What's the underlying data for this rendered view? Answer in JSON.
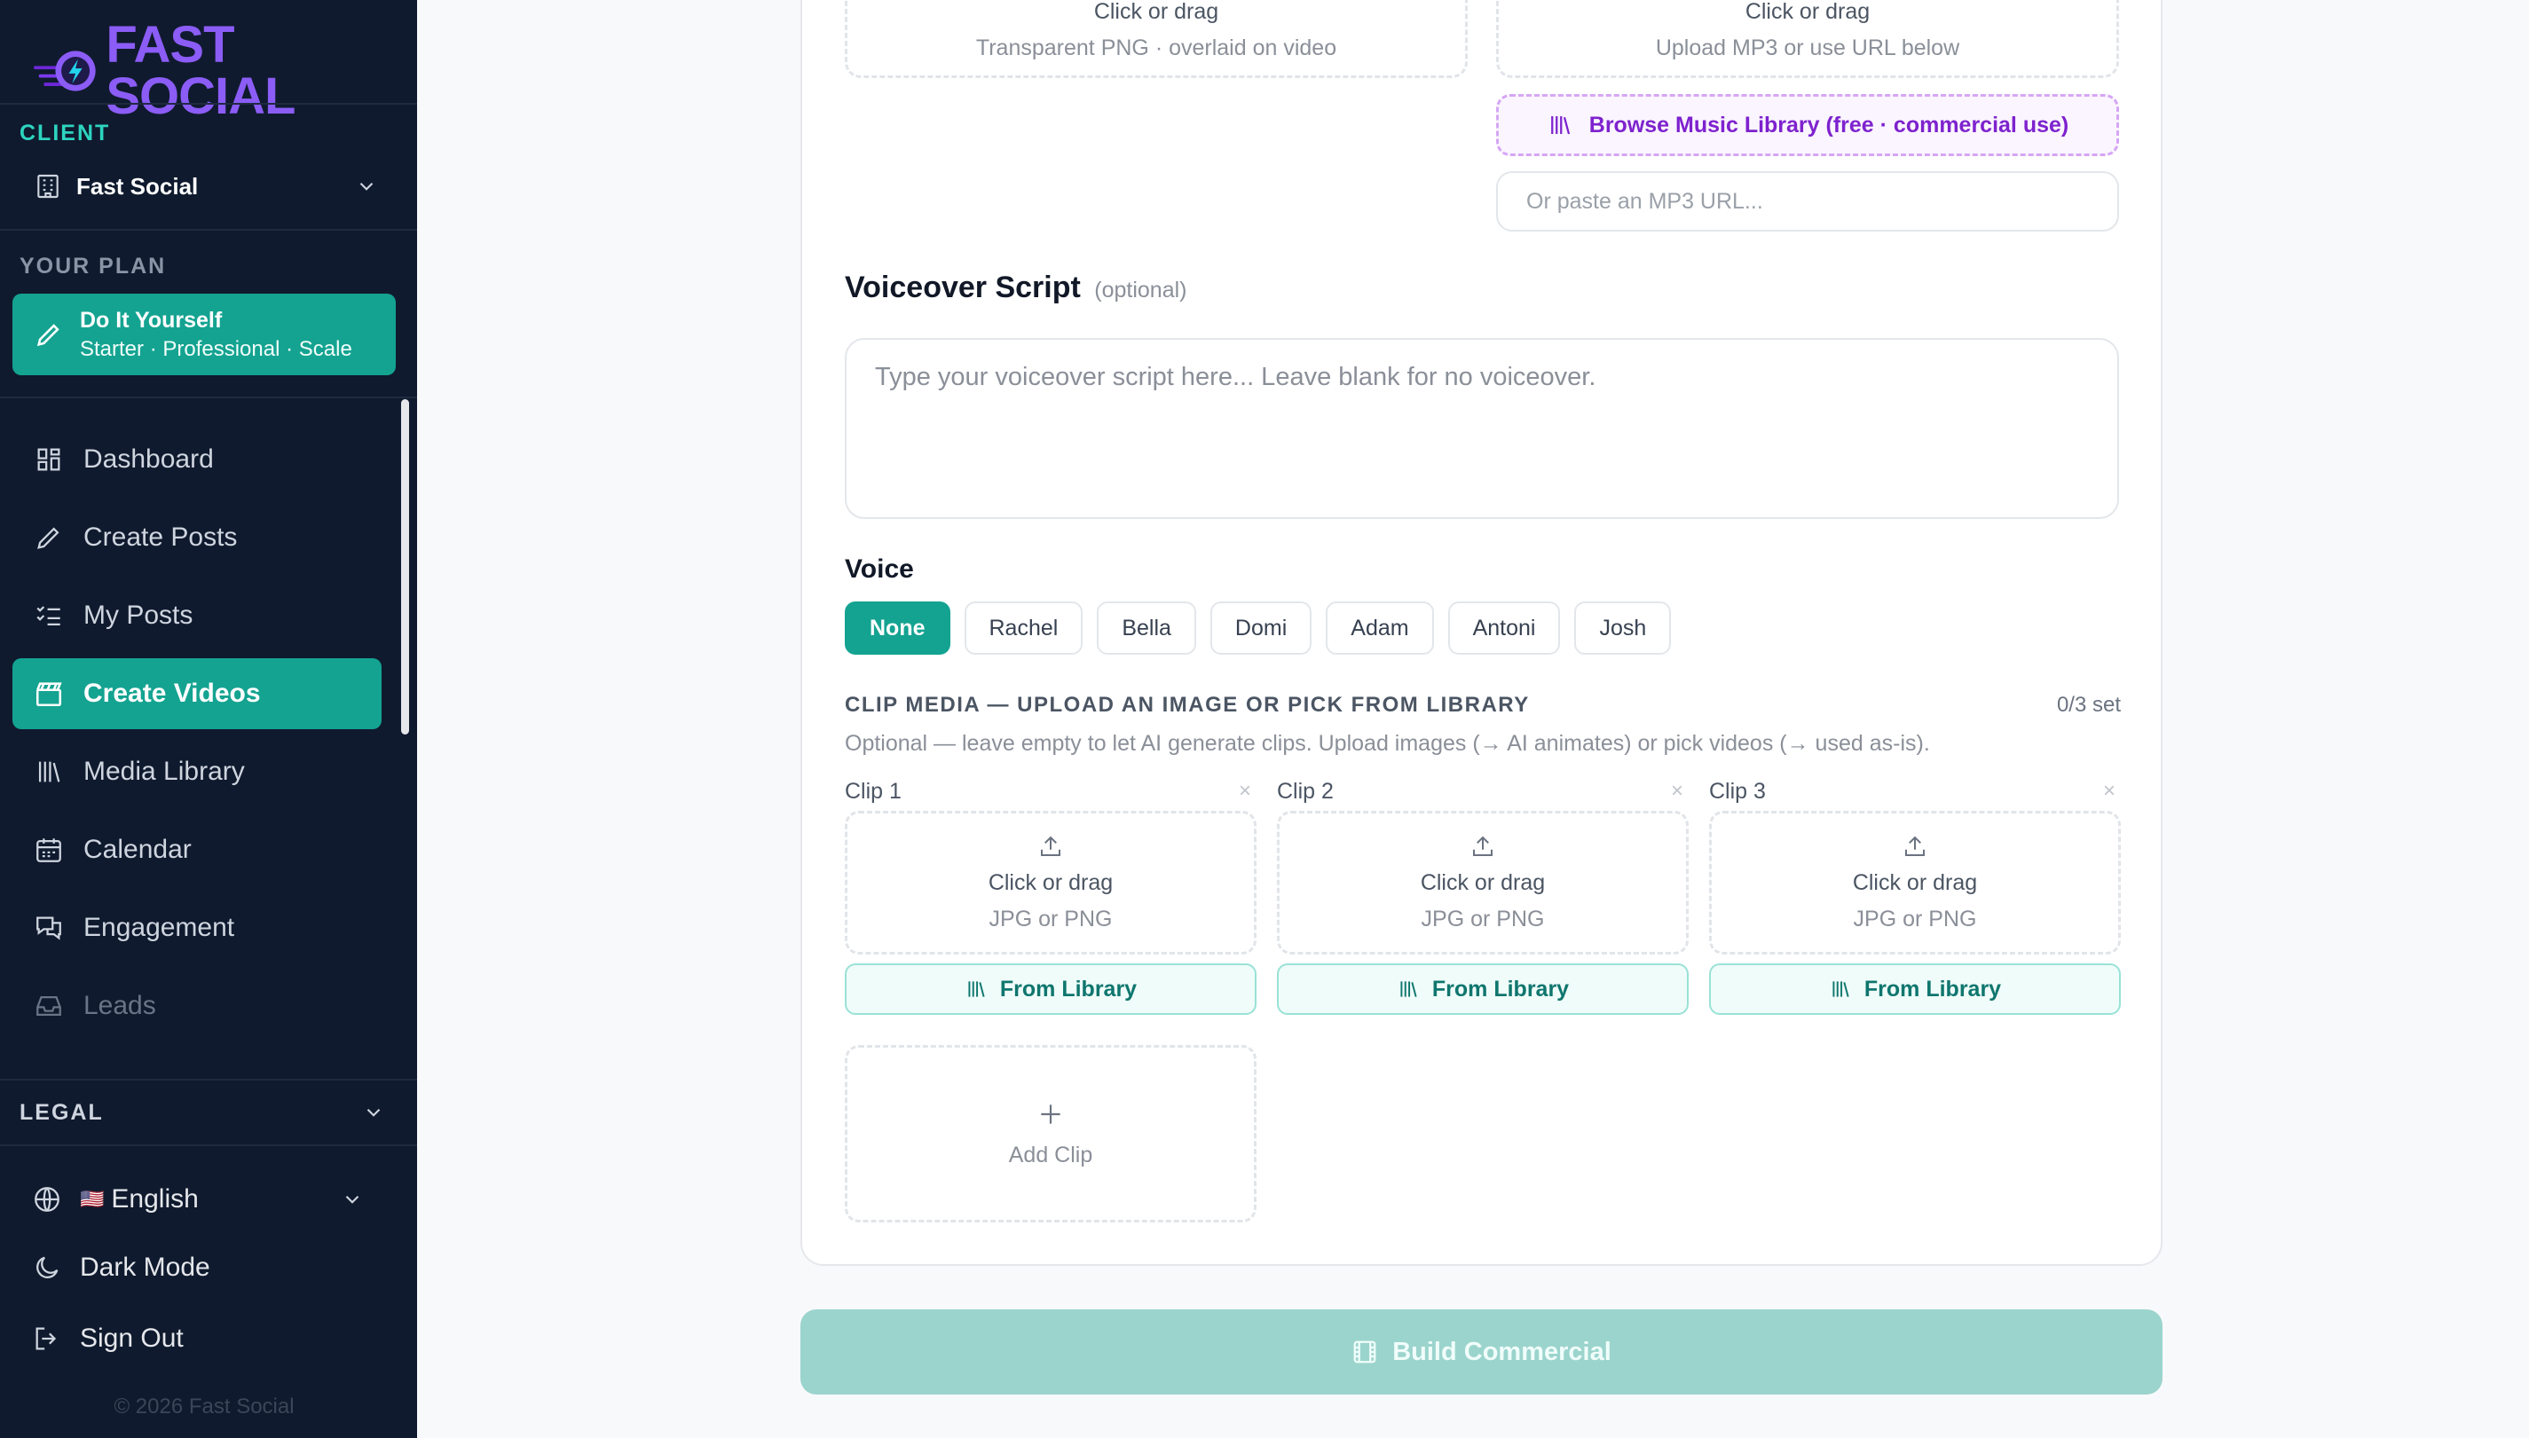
{
  "brand": {
    "name": "FAST SOCIAL",
    "accent": "#8b5cf6"
  },
  "sidebar": {
    "client_label": "CLIENT",
    "client_value": "Fast Social",
    "plan_label": "YOUR PLAN",
    "plan_name": "Do It Yourself",
    "plan_tiers": "Starter · Professional · Scale",
    "nav": [
      {
        "label": "Dashboard",
        "icon": "grid-icon"
      },
      {
        "label": "Create Posts",
        "icon": "pencil-icon"
      },
      {
        "label": "My Posts",
        "icon": "list-check-icon"
      },
      {
        "label": "Create Videos",
        "icon": "clapperboard-icon",
        "active": true
      },
      {
        "label": "Media Library",
        "icon": "library-icon"
      },
      {
        "label": "Calendar",
        "icon": "calendar-icon"
      },
      {
        "label": "Engagement",
        "icon": "chat-icon"
      },
      {
        "label": "Leads",
        "icon": "inbox-icon"
      }
    ],
    "legal_label": "LEGAL",
    "language": "English",
    "dark_mode": "Dark Mode",
    "sign_out": "Sign Out",
    "copyright": "© 2026 Fast Social"
  },
  "uploads": {
    "logo_box": {
      "title": "Click or drag",
      "subtitle": "Transparent PNG · overlaid on video"
    },
    "music_box": {
      "title": "Click or drag",
      "subtitle": "Upload MP3 or use URL below"
    },
    "music_library_button": "Browse Music Library (free · commercial use)",
    "mp3_url_placeholder": "Or paste an MP3 URL..."
  },
  "voiceover": {
    "heading": "Voiceover Script",
    "optional": "(optional)",
    "placeholder": "Type your voiceover script here... Leave blank for no voiceover."
  },
  "voice": {
    "heading": "Voice",
    "options": [
      "None",
      "Rachel",
      "Bella",
      "Domi",
      "Adam",
      "Antoni",
      "Josh"
    ],
    "selected": "None"
  },
  "clip_media": {
    "title": "CLIP MEDIA — UPLOAD AN IMAGE OR PICK FROM LIBRARY",
    "count": "0/3 set",
    "help": "Optional — leave empty to let AI generate clips. Upload images (→ AI animates) or pick videos (→ used as-is).",
    "clips": [
      {
        "label": "Clip 1",
        "remove": "×",
        "drop_title": "Click or drag",
        "drop_subtitle": "JPG or PNG",
        "library_button": "From Library"
      },
      {
        "label": "Clip 2",
        "remove": "×",
        "drop_title": "Click or drag",
        "drop_subtitle": "JPG or PNG",
        "library_button": "From Library"
      },
      {
        "label": "Clip 3",
        "remove": "×",
        "drop_title": "Click or drag",
        "drop_subtitle": "JPG or PNG",
        "library_button": "From Library"
      }
    ],
    "add_clip": "Add Clip"
  },
  "build_button": "Build Commercial",
  "colors": {
    "sidebar_bg": "#0f1a2e",
    "teal": "#14a391",
    "purple": "#7e22ce"
  }
}
